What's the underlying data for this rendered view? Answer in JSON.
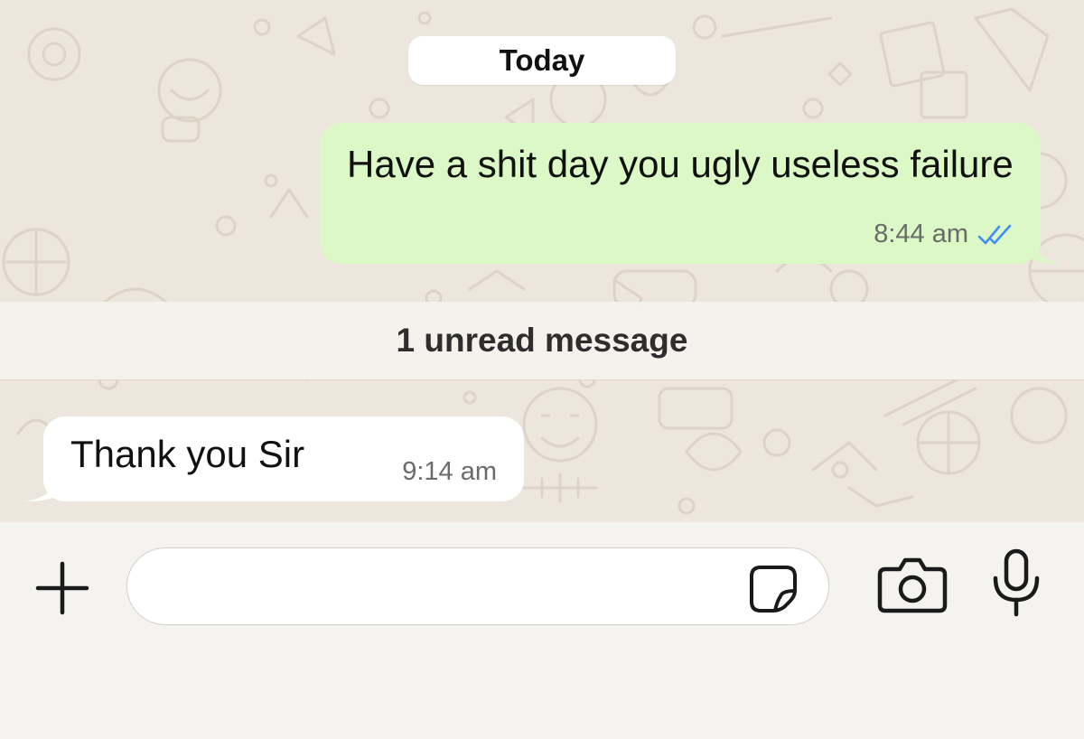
{
  "chat": {
    "date_label": "Today",
    "unread_label": "1 unread message",
    "messages": [
      {
        "direction": "outgoing",
        "text": "Have a shit day you ugly useless failure",
        "time": "8:44 am",
        "status_icon": "double-check-read-icon"
      },
      {
        "direction": "incoming",
        "text": "Thank you Sir",
        "time": "9:14 am"
      }
    ]
  },
  "composer": {
    "input_value": "",
    "icons": [
      "plus-icon",
      "sticker-icon",
      "camera-icon",
      "microphone-icon"
    ]
  },
  "colors": {
    "outgoing_bubble": "#dbf8c6",
    "incoming_bubble": "#ffffff",
    "read_ticks": "#3f8ef5",
    "wallpaper": "#ece6dd"
  }
}
